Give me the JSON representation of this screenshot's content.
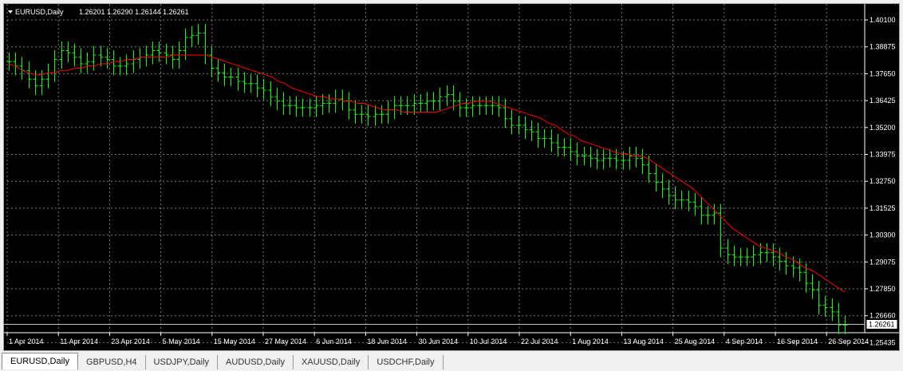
{
  "chart_header": {
    "symbol_label": "EURUSD,Daily",
    "ohlc": "1.26201 1.26290 1.26144 1.26261"
  },
  "price_axis": {
    "ticks": [
      "1.40100",
      "1.38875",
      "1.37650",
      "1.36425",
      "1.35200",
      "1.33975",
      "1.32750",
      "1.31525",
      "1.30300",
      "1.29075",
      "1.27850",
      "1.26660",
      "1.25435"
    ],
    "current_price_label": "1.26261"
  },
  "time_axis": {
    "labels": [
      "1 Apr 2014",
      "11 Apr 2014",
      "23 Apr 2014",
      "5 May 2014",
      "15 May 2014",
      "27 May 2014",
      "6 Jun 2014",
      "18 Jun 2014",
      "30 Jun 2014",
      "10 Jul 2014",
      "22 Jul 2014",
      "1 Aug 2014",
      "13 Aug 2014",
      "25 Aug 2014",
      "4 Sep 2014",
      "16 Sep 2014",
      "26 Sep 2014"
    ]
  },
  "colors": {
    "background": "#000000",
    "grid": "#7a7a7a",
    "bars": "#00ff00",
    "moving_average": "#ff0000",
    "axis_text": "#ffffff"
  },
  "chart_data": {
    "type": "bar",
    "candles": [
      1.382,
      1.38,
      1.378,
      1.374,
      1.371,
      1.374,
      1.377,
      1.383,
      1.387,
      1.386,
      1.384,
      1.381,
      1.382,
      1.385,
      1.384,
      1.383,
      1.38,
      1.38,
      1.381,
      1.383,
      1.384,
      1.385,
      1.387,
      1.386,
      1.385,
      1.383,
      1.387,
      1.393,
      1.394,
      1.395,
      1.385,
      1.379,
      1.377,
      1.375,
      1.375,
      1.373,
      1.372,
      1.372,
      1.37,
      1.369,
      1.366,
      1.364,
      1.362,
      1.362,
      1.361,
      1.361,
      1.361,
      1.362,
      1.363,
      1.363,
      1.365,
      1.364,
      1.36,
      1.358,
      1.358,
      1.357,
      1.358,
      1.358,
      1.36,
      1.362,
      1.362,
      1.362,
      1.363,
      1.363,
      1.364,
      1.364,
      1.366,
      1.367,
      1.364,
      1.361,
      1.361,
      1.362,
      1.362,
      1.362,
      1.362,
      1.361,
      1.356,
      1.353,
      1.353,
      1.351,
      1.35,
      1.347,
      1.347,
      1.345,
      1.343,
      1.343,
      1.341,
      1.339,
      1.339,
      1.338,
      1.337,
      1.338,
      1.338,
      1.337,
      1.337,
      1.339,
      1.338,
      1.335,
      1.331,
      1.327,
      1.324,
      1.321,
      1.319,
      1.319,
      1.318,
      1.316,
      1.312,
      1.312,
      1.313,
      1.297,
      1.294,
      1.293,
      1.293,
      1.293,
      1.294,
      1.295,
      1.295,
      1.293,
      1.291,
      1.289,
      1.288,
      1.286,
      1.281,
      1.278,
      1.271,
      1.27,
      1.268,
      1.262,
      1.262
    ],
    "ma": [
      1.381,
      1.38,
      1.378,
      1.377,
      1.376,
      1.376,
      1.377,
      1.377,
      1.378,
      1.378,
      1.379,
      1.379,
      1.38,
      1.38,
      1.381,
      1.381,
      1.382,
      1.382,
      1.383,
      1.383,
      1.384,
      1.384,
      1.384,
      1.384,
      1.384,
      1.385,
      1.385,
      1.385,
      1.385,
      1.385,
      1.385,
      1.384,
      1.383,
      1.382,
      1.381,
      1.38,
      1.379,
      1.378,
      1.377,
      1.376,
      1.375,
      1.373,
      1.372,
      1.37,
      1.369,
      1.368,
      1.367,
      1.366,
      1.366,
      1.365,
      1.365,
      1.364,
      1.364,
      1.363,
      1.363,
      1.362,
      1.361,
      1.36,
      1.36,
      1.36,
      1.359,
      1.359,
      1.359,
      1.359,
      1.359,
      1.359,
      1.36,
      1.361,
      1.362,
      1.363,
      1.363,
      1.364,
      1.364,
      1.364,
      1.363,
      1.362,
      1.361,
      1.36,
      1.359,
      1.358,
      1.357,
      1.356,
      1.354,
      1.353,
      1.351,
      1.349,
      1.348,
      1.346,
      1.345,
      1.344,
      1.343,
      1.342,
      1.341,
      1.34,
      1.34,
      1.339,
      1.339,
      1.338,
      1.336,
      1.334,
      1.332,
      1.33,
      1.328,
      1.326,
      1.324,
      1.321,
      1.318,
      1.315,
      1.312,
      1.309,
      1.306,
      1.304,
      1.302,
      1.3,
      1.298,
      1.297,
      1.296,
      1.295,
      1.293,
      1.292,
      1.29,
      1.288,
      1.287,
      1.285,
      1.283,
      1.281,
      1.279,
      1.277
    ]
  },
  "tabs": [
    {
      "label": "EURUSD,Daily",
      "active": true
    },
    {
      "label": "GBPUSD,H4",
      "active": false
    },
    {
      "label": "USDJPY,Daily",
      "active": false
    },
    {
      "label": "AUDUSD,Daily",
      "active": false
    },
    {
      "label": "XAUUSD,Daily",
      "active": false
    },
    {
      "label": "USDCHF,Daily",
      "active": false
    }
  ]
}
